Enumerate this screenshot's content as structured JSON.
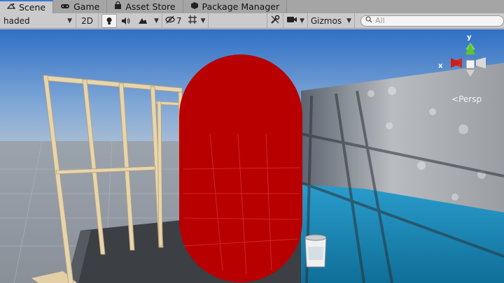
{
  "tabs": [
    {
      "label": "Scene",
      "icon": "scene-icon",
      "active": true
    },
    {
      "label": "Game",
      "icon": "gamepad-icon",
      "active": false
    },
    {
      "label": "Asset Store",
      "icon": "store-bag-icon",
      "active": false
    },
    {
      "label": "Package Manager",
      "icon": "package-icon",
      "active": false
    }
  ],
  "toolbar": {
    "shading_mode": "haded",
    "mode_2d": "2D",
    "hidden_count": "7",
    "gizmos_label": "Gizmos",
    "search_placeholder": "All"
  },
  "viewport": {
    "projection_label": "Persp",
    "axis_y": "y",
    "axis_x": "x",
    "capsule_color": "#b80000",
    "sky_color": "#3e7fd0",
    "wall_paint_color": "#1f89b8"
  }
}
